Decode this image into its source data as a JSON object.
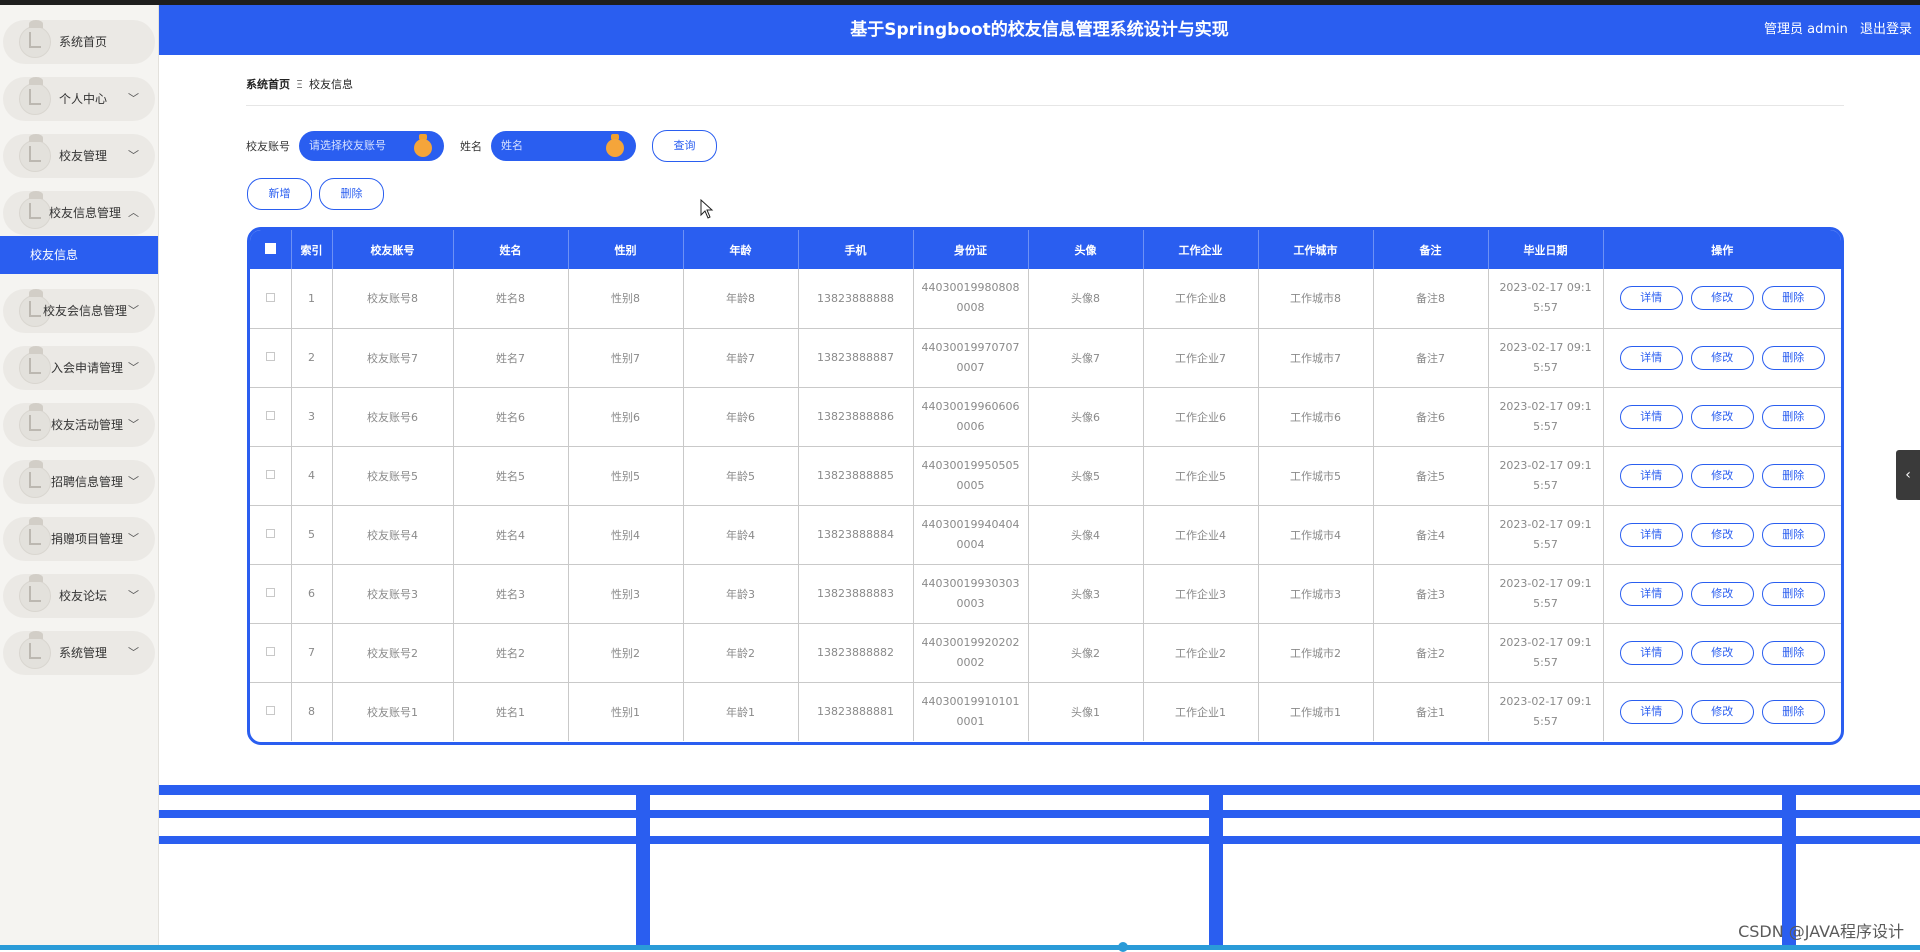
{
  "header": {
    "title": "基于Springboot的校友信息管理系统设计与实现",
    "user_label": "管理员 admin",
    "logout_label": "退出登录"
  },
  "sidebar": {
    "items": [
      {
        "label": "系统首页",
        "chevron": ""
      },
      {
        "label": "个人中心",
        "chevron": "﹀"
      },
      {
        "label": "校友管理",
        "chevron": "﹀"
      },
      {
        "label": "校友信息管理",
        "chevron": "︿"
      },
      {
        "label": "校友会信息管理",
        "chevron": "﹀"
      },
      {
        "label": "入会申请管理",
        "chevron": "﹀"
      },
      {
        "label": "校友活动管理",
        "chevron": "﹀"
      },
      {
        "label": "招聘信息管理",
        "chevron": "﹀"
      },
      {
        "label": "捐赠项目管理",
        "chevron": "﹀"
      },
      {
        "label": "校友论坛",
        "chevron": "﹀"
      },
      {
        "label": "系统管理",
        "chevron": "﹀"
      }
    ],
    "active_sub_item": "校友信息"
  },
  "breadcrumb": {
    "home": "系统首页",
    "separator": "Ξ",
    "current": "校友信息"
  },
  "search": {
    "account_label": "校友账号",
    "account_placeholder": "请选择校友账号",
    "name_label": "姓名",
    "name_placeholder": "姓名",
    "query_button": "查询"
  },
  "actions": {
    "add_button": "新增",
    "delete_button": "删除"
  },
  "table": {
    "columns": [
      "",
      "索引",
      "校友账号",
      "姓名",
      "性别",
      "年龄",
      "手机",
      "身份证",
      "头像",
      "工作企业",
      "工作城市",
      "备注",
      "毕业日期",
      "操作"
    ],
    "row_buttons": {
      "detail": "详情",
      "edit": "修改",
      "delete": "删除"
    },
    "rows": [
      {
        "index": "1",
        "account": "校友账号8",
        "name": "姓名8",
        "gender": "性别8",
        "age": "年龄8",
        "phone": "13823888888",
        "idcard": "440300199808080008",
        "avatar": "头像8",
        "company": "工作企业8",
        "city": "工作城市8",
        "remark": "备注8",
        "grad_date": "2023-02-17 09:15:57"
      },
      {
        "index": "2",
        "account": "校友账号7",
        "name": "姓名7",
        "gender": "性别7",
        "age": "年龄7",
        "phone": "13823888887",
        "idcard": "440300199707070007",
        "avatar": "头像7",
        "company": "工作企业7",
        "city": "工作城市7",
        "remark": "备注7",
        "grad_date": "2023-02-17 09:15:57"
      },
      {
        "index": "3",
        "account": "校友账号6",
        "name": "姓名6",
        "gender": "性别6",
        "age": "年龄6",
        "phone": "13823888886",
        "idcard": "440300199606060006",
        "avatar": "头像6",
        "company": "工作企业6",
        "city": "工作城市6",
        "remark": "备注6",
        "grad_date": "2023-02-17 09:15:57"
      },
      {
        "index": "4",
        "account": "校友账号5",
        "name": "姓名5",
        "gender": "性别5",
        "age": "年龄5",
        "phone": "13823888885",
        "idcard": "440300199505050005",
        "avatar": "头像5",
        "company": "工作企业5",
        "city": "工作城市5",
        "remark": "备注5",
        "grad_date": "2023-02-17 09:15:57"
      },
      {
        "index": "5",
        "account": "校友账号4",
        "name": "姓名4",
        "gender": "性别4",
        "age": "年龄4",
        "phone": "13823888884",
        "idcard": "440300199404040004",
        "avatar": "头像4",
        "company": "工作企业4",
        "city": "工作城市4",
        "remark": "备注4",
        "grad_date": "2023-02-17 09:15:57"
      },
      {
        "index": "6",
        "account": "校友账号3",
        "name": "姓名3",
        "gender": "性别3",
        "age": "年龄3",
        "phone": "13823888883",
        "idcard": "440300199303030003",
        "avatar": "头像3",
        "company": "工作企业3",
        "city": "工作城市3",
        "remark": "备注3",
        "grad_date": "2023-02-17 09:15:57"
      },
      {
        "index": "7",
        "account": "校友账号2",
        "name": "姓名2",
        "gender": "性别2",
        "age": "年龄2",
        "phone": "13823888882",
        "idcard": "440300199202020002",
        "avatar": "头像2",
        "company": "工作企业2",
        "city": "工作城市2",
        "remark": "备注2",
        "grad_date": "2023-02-17 09:15:57"
      },
      {
        "index": "8",
        "account": "校友账号1",
        "name": "姓名1",
        "gender": "性别1",
        "age": "年龄1",
        "phone": "13823888881",
        "idcard": "440300199101010001",
        "avatar": "头像1",
        "company": "工作企业1",
        "city": "工作城市1",
        "remark": "备注1",
        "grad_date": "2023-02-17 09:15:57"
      }
    ]
  },
  "watermark": "CSDN @JAVA程序设计",
  "colors": {
    "primary": "#2a5ef0",
    "knob": "#f5a53a"
  }
}
